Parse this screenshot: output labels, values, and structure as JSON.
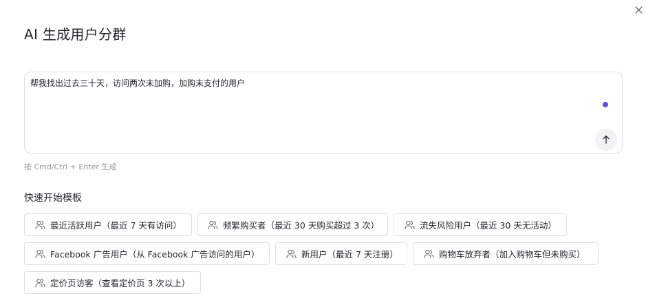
{
  "dialog": {
    "title": "AI 生成用户分群",
    "close_icon": "close-icon"
  },
  "prompt": {
    "value": "帮我找出过去三十天，访问两次未加购，加购未支付的用户",
    "status_color": "#5b4fd9",
    "send_icon": "arrow-up-icon"
  },
  "hint": "按 Cmd/Ctrl + Enter 生成",
  "templates": {
    "title": "快速开始模板",
    "icon": "users-icon",
    "items": [
      {
        "label": "最近活跃用户（最近 7 天有访问）"
      },
      {
        "label": "频繁购买者（最近 30 天购买超过 3 次）"
      },
      {
        "label": "流失风险用户（最近 30 天无活动）"
      },
      {
        "label": "Facebook 广告用户（从 Facebook 广告访问的用户）"
      },
      {
        "label": "新用户（最近 7 天注册）"
      },
      {
        "label": "购物车放弃者（加入购物车但未购买）"
      },
      {
        "label": "定价页访客（查看定价页 3 次以上）"
      }
    ]
  }
}
